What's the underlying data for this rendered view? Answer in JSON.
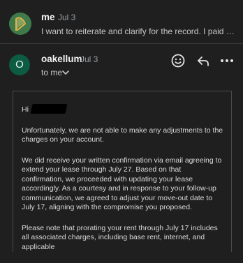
{
  "collapsed_message": {
    "sender": "me",
    "date": "Jul 3",
    "snippet": "I want to reiterate and clarify for the record. I paid my f..."
  },
  "expanded_message": {
    "avatar_letter": "O",
    "sender": "oakellum",
    "date": "Jul 3",
    "recipient": "to me"
  },
  "actions": {
    "emoji_icon": "smiley-face-icon",
    "reply_icon": "reply-arrow-icon",
    "more_icon": "more-dots-icon"
  },
  "email_body": {
    "greeting": "Hi",
    "paragraphs": [
      "Unfortunately, we are not able to make any adjustments to the charges on your account.",
      "We did receive your written confirmation via email agreeing to extend your lease through July 27. Based on that confirmation, we proceeded with updating your lease accordingly. As a courtesy and in response to your follow-up communication, we agreed to adjust your move-out date to July 17, aligning with the compromise you proposed.",
      "Please note that prorating your rent through July 17 includes all associated charges, including base rent, internet, and applicable"
    ]
  },
  "colors": {
    "background": "#1f1f1f",
    "avatar_o": "#0d5b43",
    "avatar_harp": "#3e7a4b"
  }
}
